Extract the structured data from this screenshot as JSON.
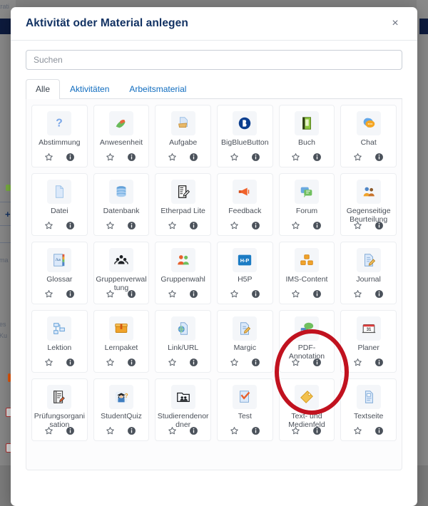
{
  "background": {
    "texts": [
      "trati",
      "ma",
      "es",
      "Ku"
    ],
    "description": "dimmed moodle course page behind modal"
  },
  "modal": {
    "title": "Aktivität oder Material anlegen",
    "close_label": "×",
    "close_icon": "close-icon",
    "search": {
      "value": "",
      "placeholder": "Suchen"
    },
    "tabs": [
      {
        "label": "Alle",
        "active": true
      },
      {
        "label": "Aktivitäten",
        "active": false
      },
      {
        "label": "Arbeitsmaterial",
        "active": false
      }
    ],
    "actions": {
      "favorite_icon": "star-outline-icon",
      "info_icon": "info-circle-icon"
    },
    "items": [
      {
        "label": "Abstimmung",
        "icon": "question-mark-icon"
      },
      {
        "label": "Anwesenheit",
        "icon": "attendance-icon"
      },
      {
        "label": "Aufgabe",
        "icon": "assignment-page-icon"
      },
      {
        "label": "BigBlueButton",
        "icon": "bigbluebutton-icon"
      },
      {
        "label": "Buch",
        "icon": "book-icon"
      },
      {
        "label": "Chat",
        "icon": "chat-bubble-icon"
      },
      {
        "label": "Datei",
        "icon": "file-icon"
      },
      {
        "label": "Datenbank",
        "icon": "database-icon"
      },
      {
        "label": "Etherpad Lite",
        "icon": "etherpad-icon"
      },
      {
        "label": "Feedback",
        "icon": "megaphone-icon"
      },
      {
        "label": "Forum",
        "icon": "forum-bubbles-icon"
      },
      {
        "label": "Gegenseitige Beurteilung",
        "icon": "workshop-people-icon"
      },
      {
        "label": "Glossar",
        "icon": "glossary-icon"
      },
      {
        "label": "Gruppenverwaltung",
        "icon": "group-management-icon"
      },
      {
        "label": "Gruppenwahl",
        "icon": "group-choice-icon"
      },
      {
        "label": "H5P",
        "icon": "h5p-icon"
      },
      {
        "label": "IMS-Content",
        "icon": "ims-content-icon"
      },
      {
        "label": "Journal",
        "icon": "journal-pencil-icon"
      },
      {
        "label": "Lektion",
        "icon": "lesson-flowchart-icon"
      },
      {
        "label": "Lernpaket",
        "icon": "scorm-package-icon"
      },
      {
        "label": "Link/URL",
        "icon": "url-globe-icon"
      },
      {
        "label": "Margic",
        "icon": "margic-pencil-icon"
      },
      {
        "label": "PDF-Annotation",
        "icon": "pdf-annotation-icon"
      },
      {
        "label": "Planer",
        "icon": "calendar-icon"
      },
      {
        "label": "Prüfungsorganisation",
        "icon": "exam-organisation-icon"
      },
      {
        "label": "StudentQuiz",
        "icon": "studentquiz-icon"
      },
      {
        "label": "Studierendenordner",
        "icon": "student-folder-icon"
      },
      {
        "label": "Test",
        "icon": "quiz-check-icon"
      },
      {
        "label": "Text- und Medienfeld",
        "icon": "label-tag-icon"
      },
      {
        "label": "Textseite",
        "icon": "page-icon"
      }
    ],
    "highlight": {
      "target_label": "PDF-Annotation",
      "shape": "ellipse",
      "color": "#c1121f"
    }
  },
  "colors": {
    "title": "#123263",
    "link": "#0f6cbf",
    "annotation": "#c1121f",
    "backdrop": "#818181"
  }
}
